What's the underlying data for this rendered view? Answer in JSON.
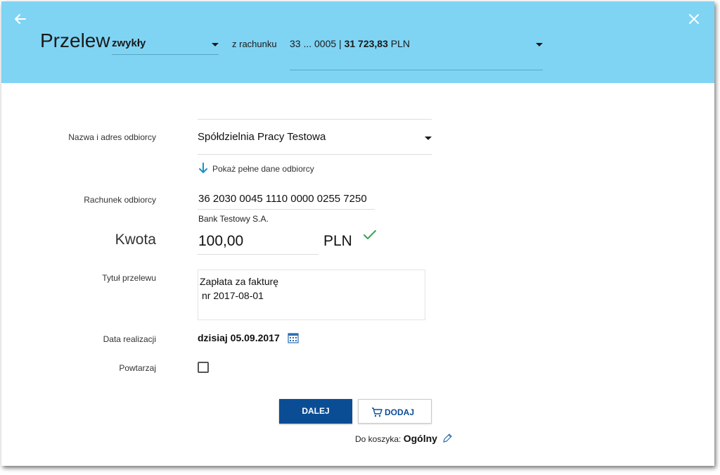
{
  "header": {
    "title": "Przelew",
    "transfer_type": "zwykły",
    "from_account_label": "z rachunku",
    "account_number": "33 ... 0005 |",
    "account_balance": "31 723,83",
    "account_currency": "PLN",
    "icons": {
      "back": "arrow-left-icon",
      "close": "close-icon"
    }
  },
  "form": {
    "recipient": {
      "label": "Nazwa i adres odbiorcy",
      "value": "Spółdzielnia Pracy Testowa",
      "show_full_link": "Pokaż pełne dane odbiorcy"
    },
    "account": {
      "label": "Rachunek odbiorcy",
      "value": "36 2030 0045 1110 0000 0255 7250",
      "bank_name": "Bank Testowy S.A."
    },
    "amount": {
      "label": "Kwota",
      "value": "100,00",
      "currency": "PLN"
    },
    "transfer_title": {
      "label": "Tytuł przelewu",
      "line1": "Zapłata za fakturę",
      "line2": "nr 2017-08-01"
    },
    "date": {
      "label": "Data realizacji",
      "value": "dzisiaj 05.09.2017"
    },
    "repeat": {
      "label": "Powtarzaj",
      "checked": false
    }
  },
  "actions": {
    "next_label": "DALEJ",
    "add_label": "DODAJ",
    "basket_label": "Do koszyka:",
    "basket_value": "Ogólny"
  },
  "colors": {
    "header_bg": "#7fd4f4",
    "primary": "#0a4d94",
    "accent_link": "#1e8fc6",
    "success": "#3aa35a"
  }
}
